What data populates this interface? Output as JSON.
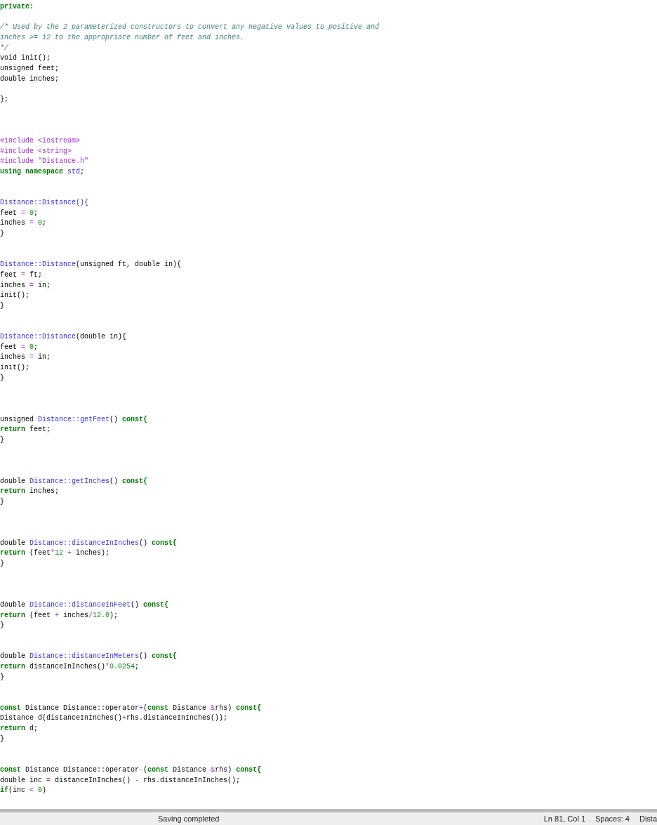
{
  "editor": {
    "lines": [
      {
        "kind": "code",
        "tokens": [
          {
            "text": "private:",
            "kind": "keyword"
          }
        ]
      },
      {
        "kind": "blank"
      },
      {
        "kind": "code",
        "tokens": [
          {
            "text": "/* Used by the 2 parameterized constructors to convert any negative values to positive and",
            "kind": "comment"
          }
        ]
      },
      {
        "kind": "code",
        "tokens": [
          {
            "text": "inches >= 12 to the appropriate number of feet and inches.",
            "kind": "comment"
          }
        ]
      },
      {
        "kind": "code",
        "tokens": [
          {
            "text": "*/",
            "kind": "comment"
          }
        ]
      },
      {
        "kind": "code",
        "tokens": [
          {
            "text": "void init();",
            "kind": "plain"
          }
        ]
      },
      {
        "kind": "code",
        "tokens": [
          {
            "text": "unsigned feet;",
            "kind": "plain"
          }
        ]
      },
      {
        "kind": "code",
        "tokens": [
          {
            "text": "double inches;",
            "kind": "plain"
          }
        ]
      },
      {
        "kind": "blank"
      },
      {
        "kind": "code",
        "tokens": [
          {
            "text": "};",
            "kind": "plain"
          }
        ]
      },
      {
        "kind": "blank"
      },
      {
        "kind": "blank"
      },
      {
        "kind": "blank"
      },
      {
        "kind": "code",
        "tokens": [
          {
            "text": "#include <iostream>",
            "kind": "preprocessor"
          }
        ]
      },
      {
        "kind": "code",
        "tokens": [
          {
            "text": "#include <string>",
            "kind": "preprocessor"
          }
        ]
      },
      {
        "kind": "code",
        "tokens": [
          {
            "text": "#include \"Distance.h\"",
            "kind": "preprocessor"
          }
        ]
      },
      {
        "kind": "code",
        "tokens": [
          {
            "text": "using namespace",
            "kind": "keyword"
          },
          {
            "text": " std",
            "kind": "name"
          },
          {
            "text": ";",
            "kind": "plain"
          }
        ]
      },
      {
        "kind": "blank"
      },
      {
        "kind": "blank"
      },
      {
        "kind": "code",
        "tokens": [
          {
            "text": "Distance::Distance(){",
            "kind": "name"
          }
        ]
      },
      {
        "kind": "code",
        "tokens": [
          {
            "text": "feet ",
            "kind": "plain"
          },
          {
            "text": "=",
            "kind": "operator"
          },
          {
            "text": " 0",
            "kind": "number"
          },
          {
            "text": ";",
            "kind": "plain"
          }
        ]
      },
      {
        "kind": "code",
        "tokens": [
          {
            "text": "inches ",
            "kind": "plain"
          },
          {
            "text": "=",
            "kind": "operator"
          },
          {
            "text": " 0",
            "kind": "number"
          },
          {
            "text": ";",
            "kind": "plain"
          }
        ]
      },
      {
        "kind": "code",
        "tokens": [
          {
            "text": "}",
            "kind": "plain"
          }
        ]
      },
      {
        "kind": "blank"
      },
      {
        "kind": "blank"
      },
      {
        "kind": "code",
        "tokens": [
          {
            "text": "Distance::Distance",
            "kind": "name"
          },
          {
            "text": "(unsigned ft, double in){",
            "kind": "plain"
          }
        ]
      },
      {
        "kind": "code",
        "tokens": [
          {
            "text": "feet ",
            "kind": "plain"
          },
          {
            "text": "=",
            "kind": "operator"
          },
          {
            "text": " ft;",
            "kind": "plain"
          }
        ]
      },
      {
        "kind": "code",
        "tokens": [
          {
            "text": "inches ",
            "kind": "plain"
          },
          {
            "text": "=",
            "kind": "operator"
          },
          {
            "text": " in;",
            "kind": "plain"
          }
        ]
      },
      {
        "kind": "code",
        "tokens": [
          {
            "text": "init();",
            "kind": "plain"
          }
        ]
      },
      {
        "kind": "code",
        "tokens": [
          {
            "text": "}",
            "kind": "plain"
          }
        ]
      },
      {
        "kind": "blank"
      },
      {
        "kind": "blank"
      },
      {
        "kind": "code",
        "tokens": [
          {
            "text": "Distance::Distance",
            "kind": "name"
          },
          {
            "text": "(double in){",
            "kind": "plain"
          }
        ]
      },
      {
        "kind": "code",
        "tokens": [
          {
            "text": "feet ",
            "kind": "plain"
          },
          {
            "text": "=",
            "kind": "operator"
          },
          {
            "text": " 0",
            "kind": "number"
          },
          {
            "text": ";",
            "kind": "plain"
          }
        ]
      },
      {
        "kind": "code",
        "tokens": [
          {
            "text": "inches ",
            "kind": "plain"
          },
          {
            "text": "=",
            "kind": "operator"
          },
          {
            "text": " in;",
            "kind": "plain"
          }
        ]
      },
      {
        "kind": "code",
        "tokens": [
          {
            "text": "init();",
            "kind": "plain"
          }
        ]
      },
      {
        "kind": "code",
        "tokens": [
          {
            "text": "}",
            "kind": "plain"
          }
        ]
      },
      {
        "kind": "blank"
      },
      {
        "kind": "blank"
      },
      {
        "kind": "blank"
      },
      {
        "kind": "code",
        "tokens": [
          {
            "text": "unsigned ",
            "kind": "plain"
          },
          {
            "text": "Distance::getFeet",
            "kind": "name"
          },
          {
            "text": "() ",
            "kind": "plain"
          },
          {
            "text": "const{",
            "kind": "keyword"
          }
        ]
      },
      {
        "kind": "code",
        "tokens": [
          {
            "text": "return",
            "kind": "keyword"
          },
          {
            "text": " feet;",
            "kind": "plain"
          }
        ]
      },
      {
        "kind": "code",
        "tokens": [
          {
            "text": "}",
            "kind": "plain"
          }
        ]
      },
      {
        "kind": "blank"
      },
      {
        "kind": "blank"
      },
      {
        "kind": "blank"
      },
      {
        "kind": "code",
        "tokens": [
          {
            "text": "double ",
            "kind": "plain"
          },
          {
            "text": "Distance::getInches",
            "kind": "name"
          },
          {
            "text": "() ",
            "kind": "plain"
          },
          {
            "text": "const{",
            "kind": "keyword"
          }
        ]
      },
      {
        "kind": "code",
        "tokens": [
          {
            "text": "return",
            "kind": "keyword"
          },
          {
            "text": " inches;",
            "kind": "plain"
          }
        ]
      },
      {
        "kind": "code",
        "tokens": [
          {
            "text": "}",
            "kind": "plain"
          }
        ]
      },
      {
        "kind": "blank"
      },
      {
        "kind": "blank"
      },
      {
        "kind": "blank"
      },
      {
        "kind": "code",
        "tokens": [
          {
            "text": "double ",
            "kind": "plain"
          },
          {
            "text": "Distance::distanceInInches",
            "kind": "name"
          },
          {
            "text": "() ",
            "kind": "plain"
          },
          {
            "text": "const{",
            "kind": "keyword"
          }
        ]
      },
      {
        "kind": "code",
        "tokens": [
          {
            "text": "return",
            "kind": "keyword"
          },
          {
            "text": " (feet",
            "kind": "plain"
          },
          {
            "text": "*",
            "kind": "operator"
          },
          {
            "text": "12",
            "kind": "number"
          },
          {
            "text": " +",
            "kind": "operator"
          },
          {
            "text": " inches);",
            "kind": "plain"
          }
        ]
      },
      {
        "kind": "code",
        "tokens": [
          {
            "text": "}",
            "kind": "plain"
          }
        ]
      },
      {
        "kind": "blank"
      },
      {
        "kind": "blank"
      },
      {
        "kind": "blank"
      },
      {
        "kind": "code",
        "tokens": [
          {
            "text": "double ",
            "kind": "plain"
          },
          {
            "text": "Distance::distanceInFeet",
            "kind": "name"
          },
          {
            "text": "() ",
            "kind": "plain"
          },
          {
            "text": "const{",
            "kind": "keyword"
          }
        ]
      },
      {
        "kind": "code",
        "tokens": [
          {
            "text": "return",
            "kind": "keyword"
          },
          {
            "text": " (feet ",
            "kind": "plain"
          },
          {
            "text": "+",
            "kind": "operator"
          },
          {
            "text": " inches",
            "kind": "plain"
          },
          {
            "text": "/",
            "kind": "operator"
          },
          {
            "text": "12.0",
            "kind": "number"
          },
          {
            "text": ");",
            "kind": "plain"
          }
        ]
      },
      {
        "kind": "code",
        "tokens": [
          {
            "text": "}",
            "kind": "plain"
          }
        ]
      },
      {
        "kind": "blank"
      },
      {
        "kind": "blank"
      },
      {
        "kind": "code",
        "tokens": [
          {
            "text": "double ",
            "kind": "plain"
          },
          {
            "text": "Distance::distanceInMeters",
            "kind": "name"
          },
          {
            "text": "() ",
            "kind": "plain"
          },
          {
            "text": "const{",
            "kind": "keyword"
          }
        ]
      },
      {
        "kind": "code",
        "tokens": [
          {
            "text": "return",
            "kind": "keyword"
          },
          {
            "text": " distanceInInches()",
            "kind": "plain"
          },
          {
            "text": "*",
            "kind": "operator"
          },
          {
            "text": "0.0254",
            "kind": "number"
          },
          {
            "text": ";",
            "kind": "plain"
          }
        ]
      },
      {
        "kind": "code",
        "tokens": [
          {
            "text": "}",
            "kind": "plain"
          }
        ]
      },
      {
        "kind": "blank"
      },
      {
        "kind": "blank"
      },
      {
        "kind": "code",
        "tokens": [
          {
            "text": "const",
            "kind": "keyword"
          },
          {
            "text": " Distance Distance::operator",
            "kind": "plain"
          },
          {
            "text": "+",
            "kind": "operator"
          },
          {
            "text": "(",
            "kind": "plain"
          },
          {
            "text": "const",
            "kind": "keyword"
          },
          {
            "text": " Distance ",
            "kind": "plain"
          },
          {
            "text": "&",
            "kind": "operator"
          },
          {
            "text": "rhs) ",
            "kind": "plain"
          },
          {
            "text": "const{",
            "kind": "keyword"
          }
        ]
      },
      {
        "kind": "code",
        "tokens": [
          {
            "text": "Distance d(distanceInInches()",
            "kind": "plain"
          },
          {
            "text": "+",
            "kind": "operator"
          },
          {
            "text": "rhs.distanceInInches());",
            "kind": "plain"
          }
        ]
      },
      {
        "kind": "code",
        "tokens": [
          {
            "text": "return",
            "kind": "keyword"
          },
          {
            "text": " d;",
            "kind": "plain"
          }
        ]
      },
      {
        "kind": "code",
        "tokens": [
          {
            "text": "}",
            "kind": "plain"
          }
        ]
      },
      {
        "kind": "blank"
      },
      {
        "kind": "blank"
      },
      {
        "kind": "code",
        "tokens": [
          {
            "text": "const",
            "kind": "keyword"
          },
          {
            "text": " Distance Distance::operator",
            "kind": "plain"
          },
          {
            "text": "-",
            "kind": "operator"
          },
          {
            "text": "(",
            "kind": "plain"
          },
          {
            "text": "const",
            "kind": "keyword"
          },
          {
            "text": " Distance ",
            "kind": "plain"
          },
          {
            "text": "&",
            "kind": "operator"
          },
          {
            "text": "rhs) ",
            "kind": "plain"
          },
          {
            "text": "const{",
            "kind": "keyword"
          }
        ]
      },
      {
        "kind": "code",
        "tokens": [
          {
            "text": "double inc ",
            "kind": "plain"
          },
          {
            "text": "=",
            "kind": "operator"
          },
          {
            "text": " distanceInInches() ",
            "kind": "plain"
          },
          {
            "text": "-",
            "kind": "operator"
          },
          {
            "text": " rhs.distanceInInches();",
            "kind": "plain"
          }
        ]
      },
      {
        "kind": "code",
        "tokens": [
          {
            "text": "if",
            "kind": "keyword"
          },
          {
            "text": "(inc ",
            "kind": "plain"
          },
          {
            "text": "<",
            "kind": "operator"
          },
          {
            "text": " 0",
            "kind": "number"
          },
          {
            "text": ")",
            "kind": "plain"
          }
        ]
      }
    ]
  },
  "status_bar": {
    "message": "Saving completed",
    "items": [
      "Ln 81, Col 1",
      "Spaces: 4",
      "Dista"
    ]
  }
}
